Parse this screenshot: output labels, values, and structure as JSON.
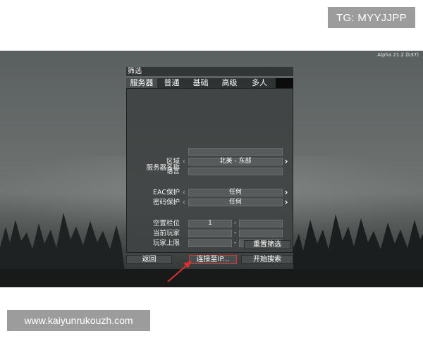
{
  "overlay": {
    "tg_label": "TG: MYYJJPP",
    "url_label": "www.kaiyunrukouzh.com"
  },
  "game": {
    "version": "Alpha 21.2 (b37)"
  },
  "panel": {
    "title": "筛选",
    "tabs": [
      {
        "label": "服务器",
        "active": true
      },
      {
        "label": "普通",
        "active": false
      },
      {
        "label": "基础",
        "active": false
      },
      {
        "label": "高级",
        "active": false
      },
      {
        "label": "多人",
        "active": false
      }
    ],
    "rows": {
      "server_name": {
        "label": "服务器名称",
        "value": ""
      },
      "region": {
        "label": "区域",
        "value": "北美 - 东部"
      },
      "language": {
        "label": "语言",
        "value": ""
      },
      "eac": {
        "label": "EAC保护",
        "value": "任何"
      },
      "password": {
        "label": "密码保护",
        "value": "任何"
      },
      "free_slots": {
        "label": "空置栏位",
        "min": "1",
        "max": "",
        "separator": "-"
      },
      "current_players": {
        "label": "当前玩家",
        "min": "",
        "max": "",
        "separator": "-"
      },
      "player_limit": {
        "label": "玩家上限",
        "min": "",
        "max": "",
        "separator": "-"
      }
    },
    "reset_label": "重置筛选"
  },
  "buttons": {
    "back": "返回",
    "connect_ip": "连接至IP...",
    "start_search": "开始搜索"
  },
  "icons": {
    "left": "‹",
    "right": "›"
  },
  "colors": {
    "highlight": "#d23a3a"
  }
}
